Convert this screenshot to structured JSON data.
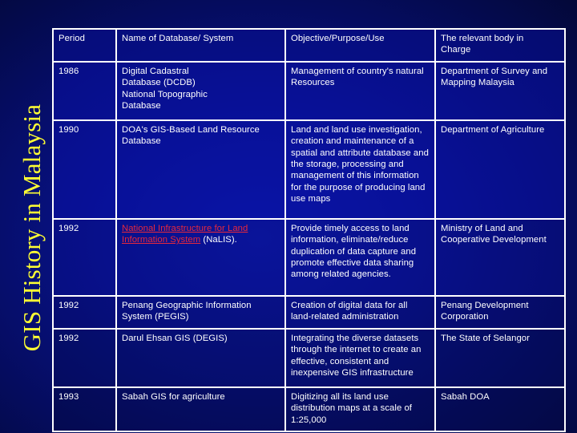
{
  "slide": {
    "title": "GIS History in Malaysia",
    "colors": {
      "title": "#ffff33",
      "text": "#ffffff",
      "link": "#e8283c",
      "background": "#08128a"
    }
  },
  "table": {
    "headers": {
      "period": "Period",
      "name": "Name of Database/ System",
      "objective": "Objective/Purpose/Use",
      "body": "The relevant body in Charge"
    },
    "rows": [
      {
        "period": "1986",
        "name": "Digital Cadastral Database (DCDB) National Topographic Database",
        "objective": "Management of country's natural Resources",
        "body": "Department of Survey and Mapping Malaysia"
      },
      {
        "period": "1990",
        "name": "DOA's GIS-Based Land Resource Database",
        "objective": "Land and land use investigation, creation and maintenance of a spatial and attribute database and the storage, processing and management of this information for the purpose of producing land use maps",
        "body": "Department of Agriculture"
      },
      {
        "period": "1992",
        "name_link": "National Infrastructure for Land Information System",
        "name_suffix": " (NaLIS).",
        "objective": "Provide timely access to land information, eliminate/reduce duplication of data capture and promote effective data sharing among related agencies.",
        "body": "Ministry of Land and Cooperative Development"
      },
      {
        "period": "1992",
        "name": "Penang Geographic Information System (PEGIS)",
        "objective": "Creation of digital data for all land-related administration",
        "body": "Penang Development Corporation"
      },
      {
        "period": "1992",
        "name": "Darul Ehsan GIS (DEGIS)",
        "objective": "Integrating the diverse datasets through the internet to create an effective, consistent and inexpensive GIS infrastructure",
        "body": "The State of Selangor"
      },
      {
        "period": "1993",
        "name": "Sabah GIS for agriculture",
        "objective": "Digitizing all its land use distribution maps at a scale of 1:25,000",
        "body": "Sabah DOA"
      }
    ]
  }
}
